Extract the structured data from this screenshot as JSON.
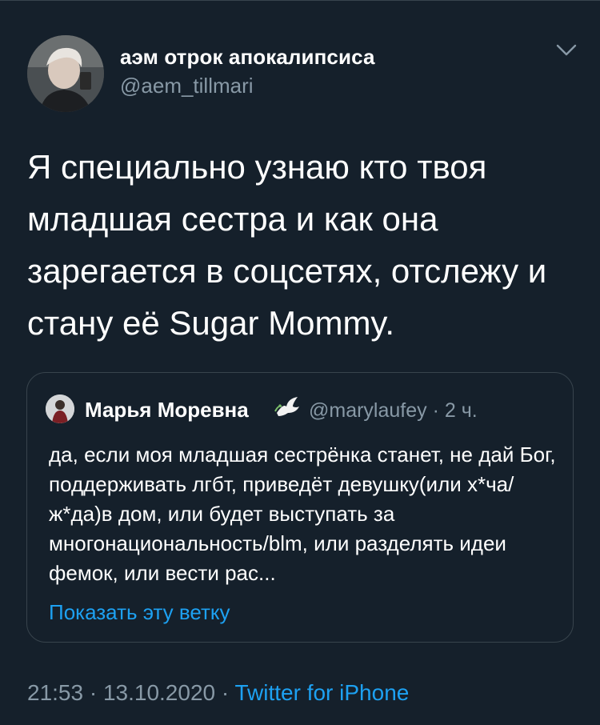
{
  "tweet": {
    "author": {
      "display_name": "аэм отрок апокалипсиса",
      "handle": "@aem_tillmari"
    },
    "text": "Я специально узнаю кто твоя младшая сестра и как она зарегается в соцсетях, отслежу и стану её Sugar Mommy.",
    "quoted": {
      "display_name": "Марья Моревна",
      "handle_time": "@marylaufey · 2 ч.",
      "text": "да, если моя младшая сестрёнка станет, не дай Бог, поддерживать лгбт, приведёт девушку(или х*ча/ж*да)в дом, или будет выступать за многонациональность/blm, или разделять идеи фемок, или вести рас...",
      "thread_link": "Показать эту ветку"
    },
    "footer": {
      "datetime": "21:53 · 13.10.2020 · ",
      "source": "Twitter for iPhone"
    }
  },
  "icons": {
    "more": "chevron-down-icon",
    "dove": "dove-icon"
  },
  "colors": {
    "background": "#15202b",
    "text_primary": "#ffffff",
    "text_secondary": "#8899a6",
    "link": "#1da1f2",
    "border": "#38444d"
  }
}
